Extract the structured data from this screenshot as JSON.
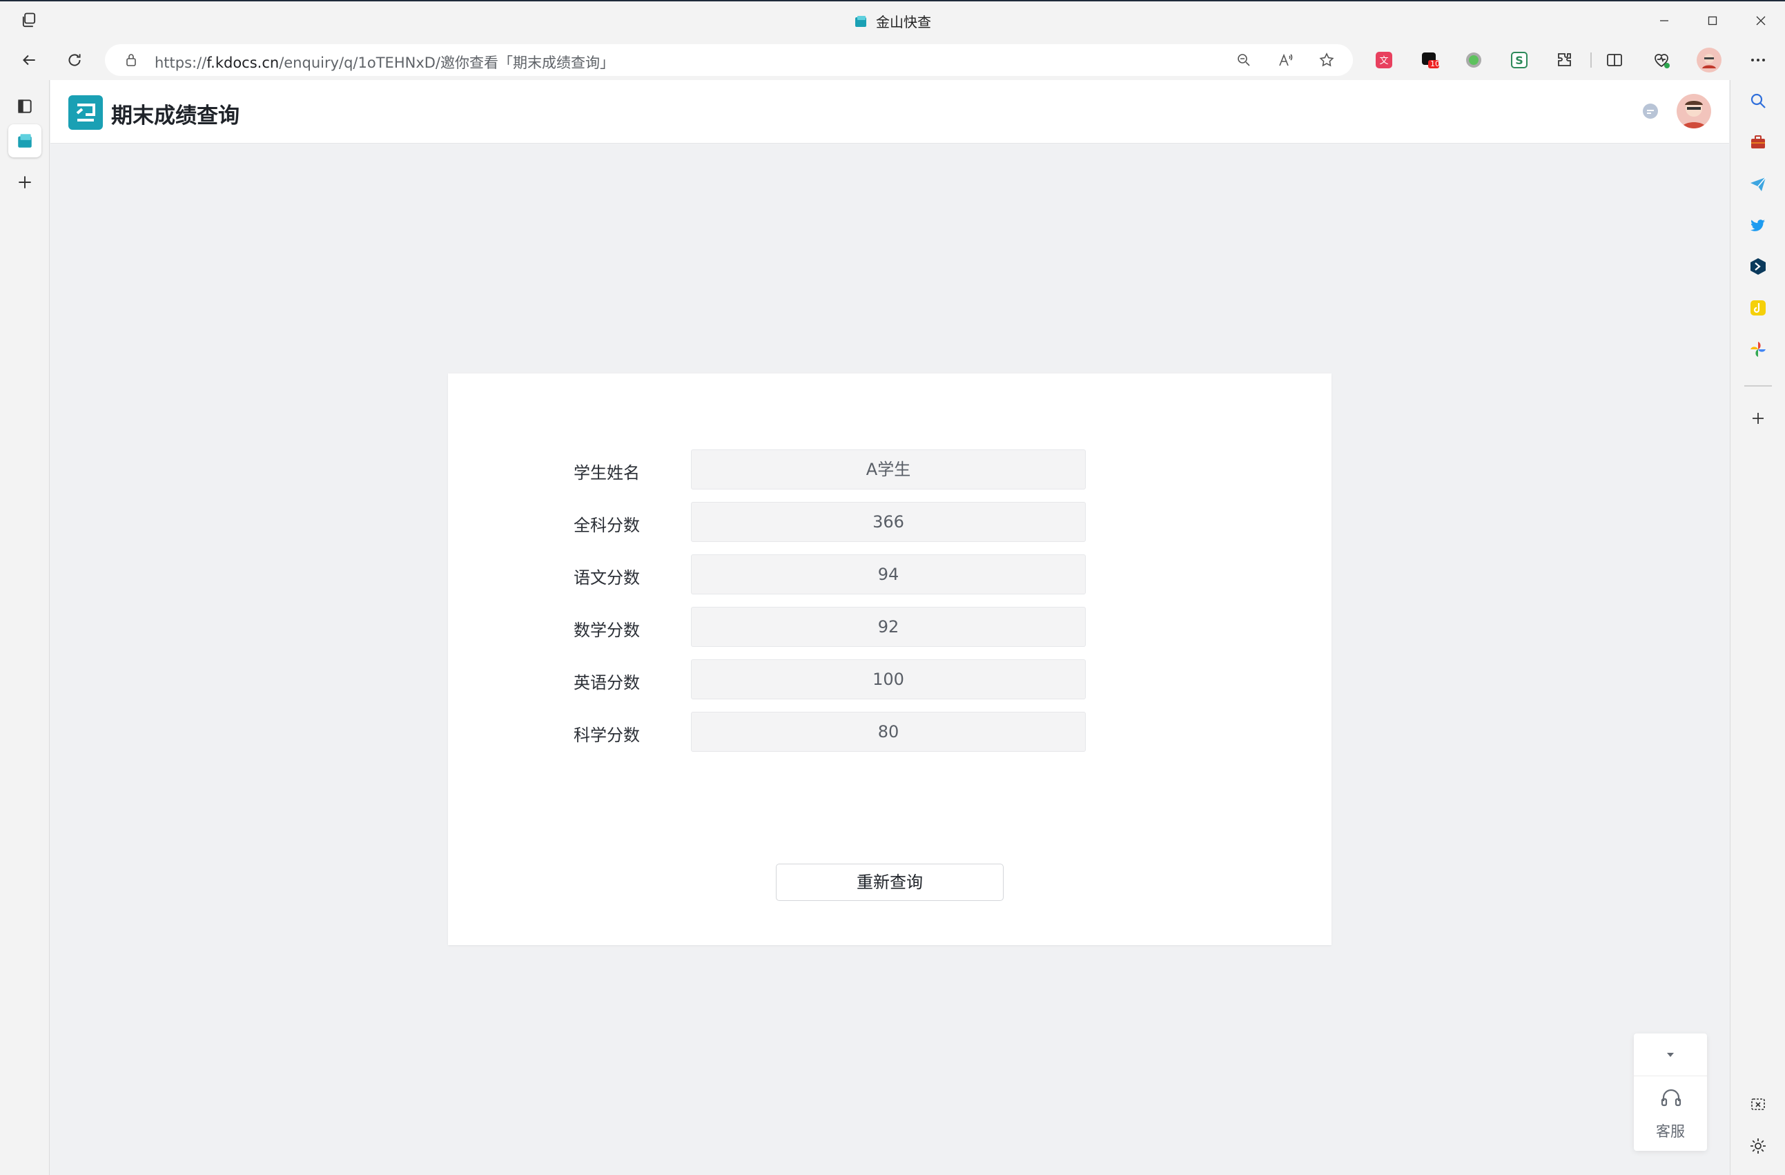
{
  "window": {
    "title": "金山快查"
  },
  "address_bar": {
    "url_prefix": "https://",
    "url_host": "f.kdocs.cn",
    "url_rest": "/enquiry/q/1oTEHNxD/邀你查看「期末成绩查询」",
    "extension_badge": "10"
  },
  "page": {
    "title": "期末成绩查询"
  },
  "result": {
    "fields": [
      {
        "label": "学生姓名",
        "value": "A学生"
      },
      {
        "label": "全科分数",
        "value": "366"
      },
      {
        "label": "语文分数",
        "value": "94"
      },
      {
        "label": "数学分数",
        "value": "92"
      },
      {
        "label": "英语分数",
        "value": "100"
      },
      {
        "label": "科学分数",
        "value": "80"
      }
    ],
    "requery_label": "重新查询"
  },
  "service_widget": {
    "label": "客服"
  },
  "colors": {
    "brand": "#1aa0b4",
    "page_bg": "#f0f1f3",
    "field_bg": "#f4f4f5"
  }
}
